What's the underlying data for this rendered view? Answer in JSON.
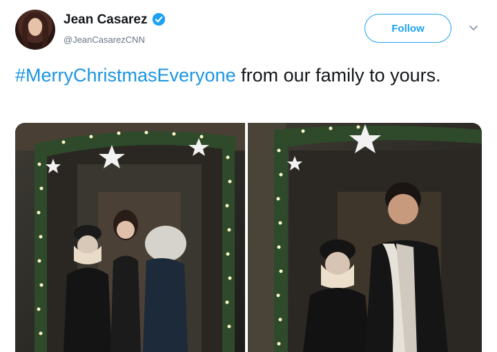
{
  "author": {
    "name": "Jean Casarez",
    "handle": "@JeanCasarezCNN",
    "verified": true,
    "avatar_icon": "profile-photo"
  },
  "actions": {
    "follow_label": "Follow",
    "menu_icon": "chevron-down-icon"
  },
  "tweet": {
    "hashtag": "#MerryChristmasEveryone",
    "text": " from our family to yours."
  },
  "colors": {
    "accent": "#1da1f2",
    "hashtag": "#1b95e0",
    "handle": "#657786"
  },
  "media": {
    "photos": [
      {
        "name": "photo-left",
        "description_icon": "christmas-doorway-photo"
      },
      {
        "name": "photo-right",
        "description_icon": "christmas-doorway-photo"
      }
    ]
  }
}
